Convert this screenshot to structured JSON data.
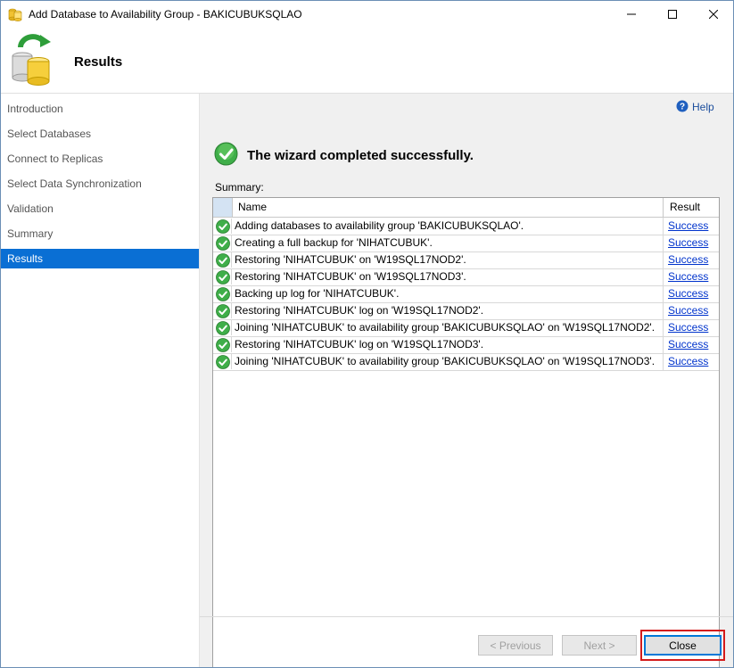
{
  "window": {
    "title": "Add Database to Availability Group - BAKICUBUKSQLAO",
    "controls": {
      "minimize_icon": "minimize-icon",
      "maximize_icon": "maximize-icon",
      "close_icon": "close-icon"
    }
  },
  "header": {
    "title": "Results",
    "icon": "database-refresh-icon"
  },
  "sidebar": {
    "items": [
      {
        "label": "Introduction",
        "active": false
      },
      {
        "label": "Select Databases",
        "active": false
      },
      {
        "label": "Connect to Replicas",
        "active": false
      },
      {
        "label": "Select Data Synchronization",
        "active": false
      },
      {
        "label": "Validation",
        "active": false
      },
      {
        "label": "Summary",
        "active": false
      },
      {
        "label": "Results",
        "active": true
      }
    ],
    "active_color": "#0a6fd4"
  },
  "help": {
    "label": "Help",
    "icon": "help-icon"
  },
  "status": {
    "message": "The wizard completed successfully.",
    "icon": "success-check-icon"
  },
  "summary": {
    "label": "Summary:",
    "columns": [
      "Name",
      "Result"
    ],
    "rows": [
      {
        "name": "Adding databases to availability group 'BAKICUBUKSQLAO'.",
        "result": "Success"
      },
      {
        "name": "Creating a full backup for 'NIHATCUBUK'.",
        "result": "Success"
      },
      {
        "name": "Restoring 'NIHATCUBUK' on 'W19SQL17NOD2'.",
        "result": "Success"
      },
      {
        "name": "Restoring 'NIHATCUBUK' on 'W19SQL17NOD3'.",
        "result": "Success"
      },
      {
        "name": "Backing up log for 'NIHATCUBUK'.",
        "result": "Success"
      },
      {
        "name": "Restoring 'NIHATCUBUK' log on 'W19SQL17NOD2'.",
        "result": "Success"
      },
      {
        "name": "Joining 'NIHATCUBUK' to availability group 'BAKICUBUKSQLAO' on 'W19SQL17NOD2'.",
        "result": "Success"
      },
      {
        "name": "Restoring 'NIHATCUBUK' log on 'W19SQL17NOD3'.",
        "result": "Success"
      },
      {
        "name": "Joining 'NIHATCUBUK' to availability group 'BAKICUBUKSQLAO' on 'W19SQL17NOD3'.",
        "result": "Success"
      }
    ]
  },
  "buttons": {
    "previous": {
      "label": "< Previous",
      "enabled": false
    },
    "next": {
      "label": "Next >",
      "enabled": false
    },
    "close": {
      "label": "Close",
      "enabled": true
    }
  }
}
